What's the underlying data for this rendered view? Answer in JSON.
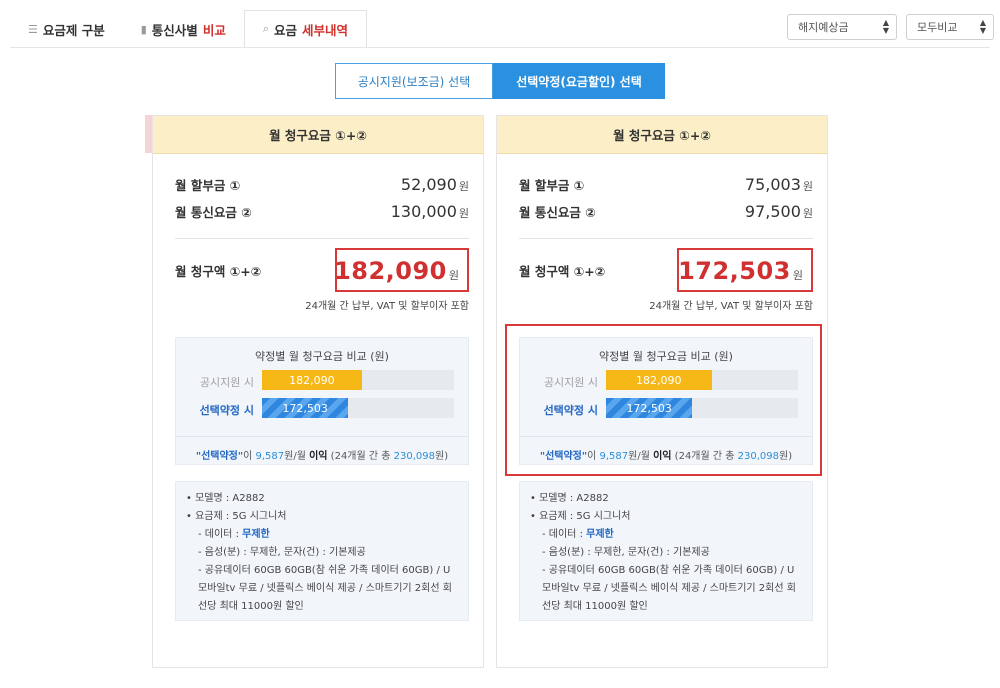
{
  "tabs": [
    {
      "label": "요금제 구분",
      "icon": "list-icon"
    },
    {
      "label": "통신사별",
      "highlight": "비교",
      "icon": "bar-chart-icon"
    },
    {
      "label": "요금",
      "highlight": "세부내역",
      "icon": "search-icon",
      "active": true
    }
  ],
  "selects": {
    "first": "해지예상금",
    "second": "모두비교"
  },
  "toggle": {
    "option_a": "공시지원(보조금) 선택",
    "option_b": "선택약정(요금할인) 선택"
  },
  "cards": [
    {
      "header": "월 청구요금 ①+②",
      "installment_label": "월 할부금 ①",
      "installment_value": "52,090",
      "fee_label": "월 통신요금 ②",
      "fee_value": "130,000",
      "total_label": "월 청구액 ①+②",
      "total_value": "182,090",
      "won": "원",
      "note": "24개월 간 납부, VAT 및 할부이자 포함",
      "compare_title": "약정별 월 청구요금 비교 (원)",
      "bar_a_label": "공시지원 시",
      "bar_a_value": "182,090",
      "bar_b_label": "선택약정 시",
      "bar_b_value": "172,503",
      "foot_kw": "\"선택약정\"",
      "foot_mid": "이 ",
      "foot_num": "9,587",
      "foot_mid2": "원/월 ",
      "foot_gain": "이익",
      "foot_paren_a": " (24개월 간 총 ",
      "foot_total": "230,098",
      "foot_paren_b": "원)",
      "info": {
        "model": "• 모델명 : A2882",
        "plan": "• 요금제 : 5G 시그니처",
        "data_prefix": "- 데이터 : ",
        "data_value": "무제한",
        "voice": "- 음성(분) : 무제한,  문자(건) : 기본제공",
        "extra": "- 공유데이터 60GB 60GB(참 쉬운 가족 데이터 60GB) / U 모바일tv 무료 / 넷플릭스 베이식 제공 / 스마트기기 2회선 회선당 최대 11000원 할인"
      }
    },
    {
      "header": "월 청구요금 ①+②",
      "installment_label": "월 할부금 ①",
      "installment_value": "75,003",
      "fee_label": "월 통신요금 ②",
      "fee_value": "97,500",
      "total_label": "월 청구액 ①+②",
      "total_value": "172,503",
      "won": "원",
      "note": "24개월 간 납부, VAT 및 할부이자 포함",
      "compare_title": "약정별 월 청구요금 비교 (원)",
      "bar_a_label": "공시지원 시",
      "bar_a_value": "182,090",
      "bar_b_label": "선택약정 시",
      "bar_b_value": "172,503",
      "foot_kw": "\"선택약정\"",
      "foot_mid": "이 ",
      "foot_num": "9,587",
      "foot_mid2": "원/월 ",
      "foot_gain": "이익",
      "foot_paren_a": " (24개월 간 총 ",
      "foot_total": "230,098",
      "foot_paren_b": "원)",
      "info": {
        "model": "• 모델명 : A2882",
        "plan": "• 요금제 : 5G 시그니처",
        "data_prefix": "- 데이터 : ",
        "data_value": "무제한",
        "voice": "- 음성(분) : 무제한,  문자(건) : 기본제공",
        "extra": "- 공유데이터 60GB 60GB(참 쉬운 가족 데이터 60GB) / U 모바일tv 무료 / 넷플릭스 베이식 제공 / 스마트기기 2회선 회선당 최대 11000원 할인"
      }
    }
  ],
  "colors": {
    "accent_blue": "#2a90e0",
    "highlight_red": "#d83a3a",
    "bar_yellow": "#f6b817",
    "header_cream": "#fcefc7"
  }
}
